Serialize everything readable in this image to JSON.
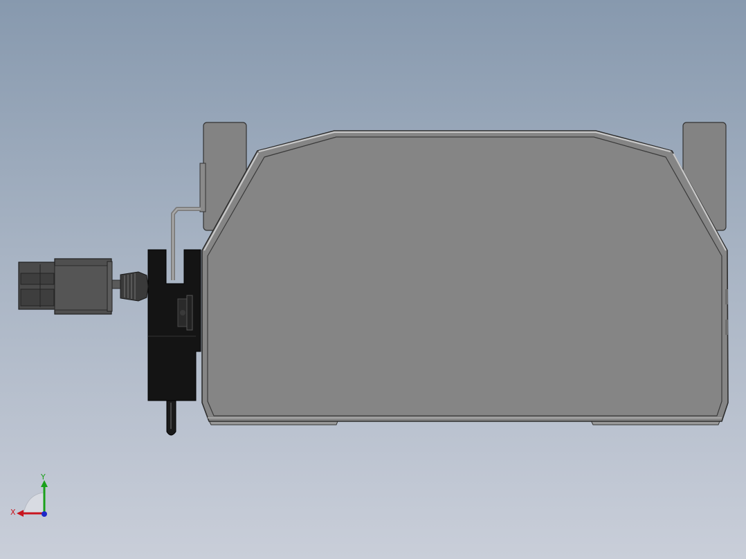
{
  "view": {
    "background_top": "#8799ae",
    "background_bottom": "#c9ced9",
    "part_color": "#858585",
    "edge_color": "#3a3a3a",
    "bracket_color": "#141414"
  },
  "triad": {
    "y_label": "Y",
    "x_label": "X",
    "y_color": "#1aa01a",
    "x_color": "#c8141e",
    "z_color": "#1e28c8"
  }
}
